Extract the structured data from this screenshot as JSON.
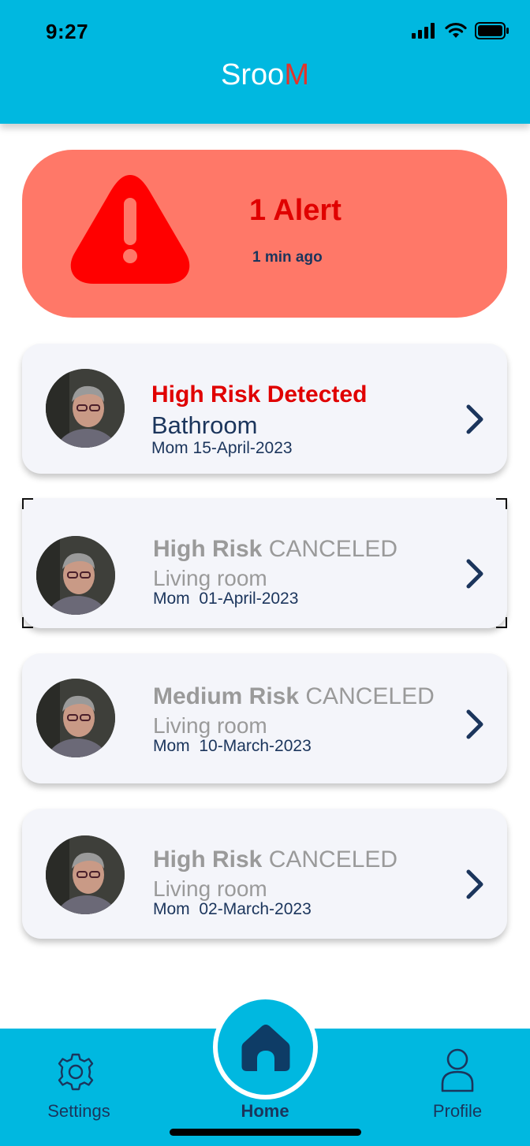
{
  "status_bar": {
    "time": "9:27"
  },
  "app": {
    "logo_main": "Sroo",
    "logo_accent": "M",
    "accent_color": "#e2342b",
    "brand_color": "#00b8e0"
  },
  "alert": {
    "title": "1 Alert",
    "time": "1 min ago",
    "icon": "warning-triangle-icon",
    "color": "#ff7868"
  },
  "cards": [
    {
      "risk": "High Risk Detected",
      "status": "",
      "room": "Bathroom",
      "person": "Mom",
      "date": "15-April-2023"
    },
    {
      "risk": "High Risk",
      "status": "CANCELED",
      "room": "Living room",
      "person": "Mom",
      "date": "01-April-2023"
    },
    {
      "risk": "Medium Risk",
      "status": "CANCELED",
      "room": "Living room",
      "person": "Mom",
      "date": "10-March-2023"
    },
    {
      "risk": "High Risk",
      "status": "CANCELED",
      "room": "Living room",
      "person": "Mom",
      "date": "02-March-2023"
    }
  ],
  "nav": {
    "settings_label": "Settings",
    "home_label": "Home",
    "profile_label": "Profile"
  }
}
